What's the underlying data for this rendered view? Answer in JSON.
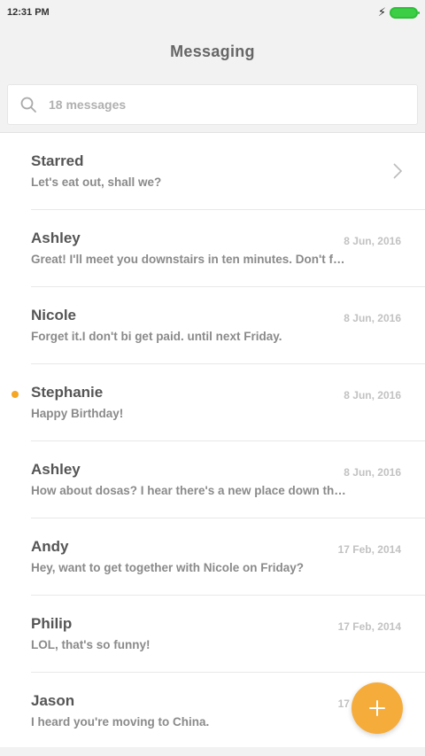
{
  "status_bar": {
    "time": "12:31 PM"
  },
  "header": {
    "title": "Messaging"
  },
  "search": {
    "placeholder": "18 messages"
  },
  "conversations": [
    {
      "name": "Starred",
      "snippet": "Let's eat out, shall we?",
      "date": ""
    },
    {
      "name": "Ashley",
      "snippet": "Great! I'll meet you downstairs in ten minutes. Don't fo...",
      "date": "8 Jun, 2016"
    },
    {
      "name": "Nicole",
      "snippet": "Forget it.I don't bi get paid. until next Friday.",
      "date": "8 Jun, 2016"
    },
    {
      "name": "Stephanie",
      "snippet": "Happy Birthday!",
      "date": "8 Jun, 2016"
    },
    {
      "name": "Ashley",
      "snippet": "How about dosas? I hear there's a new place down the...",
      "date": "8 Jun, 2016"
    },
    {
      "name": "Andy",
      "snippet": "Hey, want to get together with Nicole on Friday?",
      "date": "17 Feb, 2014"
    },
    {
      "name": "Philip",
      "snippet": "LOL, that's so funny!",
      "date": "17 Feb, 2014"
    },
    {
      "name": "Jason",
      "snippet": "I heard you're moving to China.",
      "date": "17 Feb, 2014"
    }
  ],
  "colors": {
    "accent": "#f5ac3b",
    "unread": "#f5a623",
    "battery": "#3ccf45"
  },
  "icons": {
    "search": "search-icon",
    "chevron": "chevron-right-icon",
    "fab": "plus-icon",
    "charging": "lightning-icon",
    "battery": "battery-icon"
  }
}
